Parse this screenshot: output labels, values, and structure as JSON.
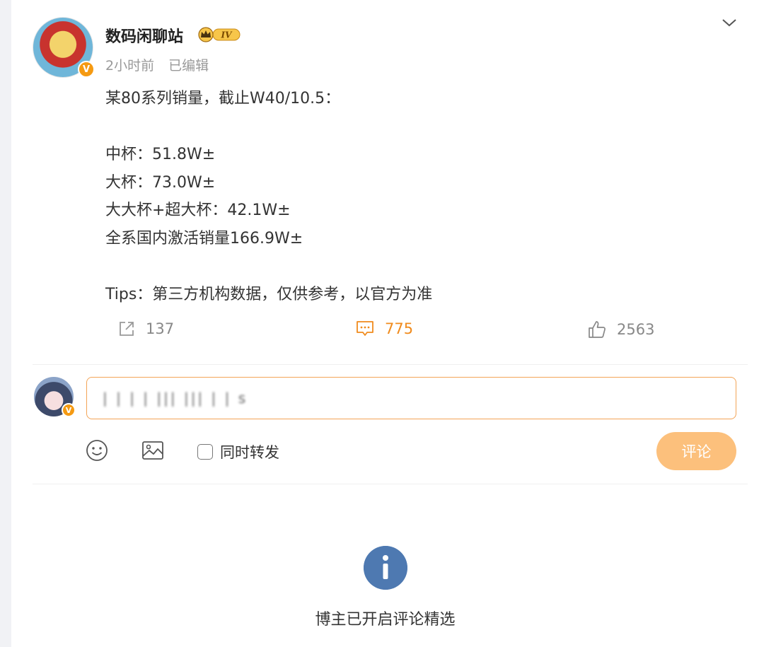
{
  "post": {
    "author": "数码闲聊站",
    "level_badge": "IV",
    "verified_badge": "V",
    "time": "2小时前",
    "edited": "已编辑",
    "text": "某80系列销量，截止W40/10.5：\n\n中杯：51.8W±\n大杯：73.0W±\n大大杯+超大杯：42.1W±\n全系国内激活销量166.9W±\n\nTips：第三方机构数据，仅供参考，以官方为准"
  },
  "actions": {
    "repost_count": "137",
    "comment_count": "775",
    "like_count": "2563"
  },
  "composer": {
    "input_value": "| | | | ||| ||| | | s",
    "verified_badge": "V",
    "repost_checkbox_label": "同时转发",
    "repost_checked": false,
    "submit_label": "评论"
  },
  "notice": {
    "text": "博主已开启评论精选",
    "icon": "info-icon"
  },
  "colors": {
    "accent": "#f08b1d",
    "submit_disabled": "#fcc07c",
    "verified": "#f59a12",
    "info": "#4e79b1"
  }
}
